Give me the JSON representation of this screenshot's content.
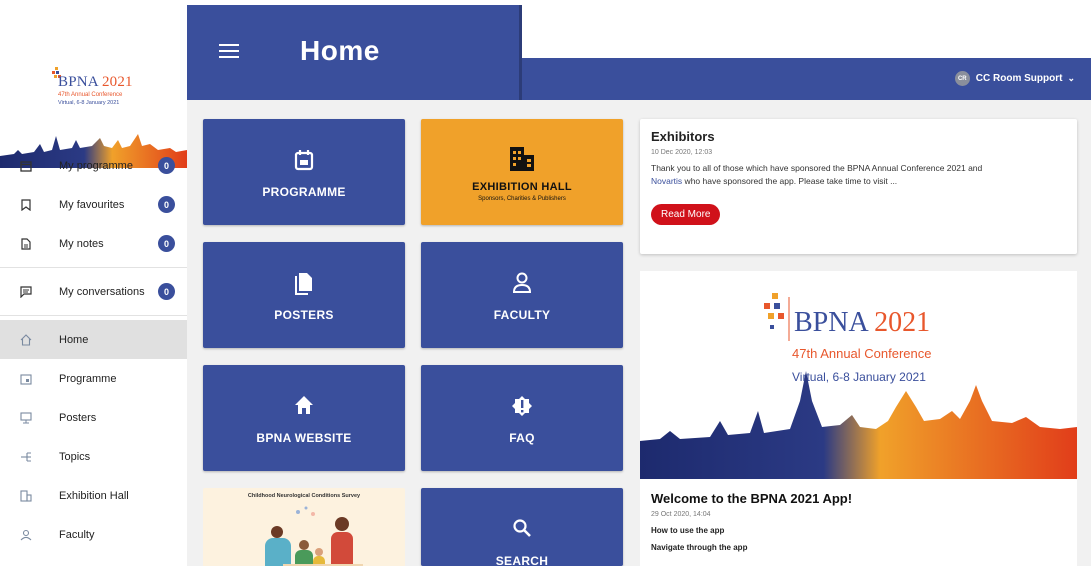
{
  "logo": {
    "title": "BPNA",
    "year": "2021",
    "subtitle": "47th Annual Conference",
    "dates": "Virtual, 6-8 January 2021"
  },
  "header": {
    "title": "Home",
    "user": {
      "initials": "CR",
      "name": "CC Room Support"
    }
  },
  "sidebar": {
    "items": [
      {
        "label": "My programme",
        "icon": "calendar-icon",
        "badge": "0"
      },
      {
        "label": "My favourites",
        "icon": "bookmark-icon",
        "badge": "0"
      },
      {
        "label": "My notes",
        "icon": "document-icon",
        "badge": "0"
      },
      {
        "label": "My conversations",
        "icon": "chat-icon",
        "badge": "0"
      },
      {
        "label": "Home",
        "icon": "home-icon",
        "active": true
      },
      {
        "label": "Programme",
        "icon": "calendar-icon"
      },
      {
        "label": "Posters",
        "icon": "presentation-icon"
      },
      {
        "label": "Topics",
        "icon": "topics-icon"
      },
      {
        "label": "Exhibition Hall",
        "icon": "building-icon"
      },
      {
        "label": "Faculty",
        "icon": "person-icon"
      }
    ]
  },
  "tiles": {
    "programme": "PROGRAMME",
    "exhibition": "EXHIBITION HALL",
    "exhibition_sub": "Sponsors, Charities & Publishers",
    "posters": "POSTERS",
    "faculty": "FACULTY",
    "website": "BPNA WEBSITE",
    "faq": "FAQ",
    "search": "SEARCH",
    "survey": "Childhood Neurological Conditions Survey"
  },
  "news": [
    {
      "title": "Exhibitors",
      "date": "10 Dec 2020, 12:03",
      "body_1": "Thank you to all of those which have sponsored the BPNA Annual Conference 2021 and",
      "body_link": "Novartis",
      "body_2": " who have sponsored the app. Please take time to visit ...",
      "button": "Read More"
    }
  ],
  "banner": {
    "title": "BPNA",
    "year": "2021",
    "line1": "47th Annual Conference",
    "line2": "Virtual, 6-8 January 2021"
  },
  "welcome": {
    "title": "Welcome to the BPNA 2021 App!",
    "date": "29 Oct 2020, 14:04",
    "link1": "How to use the app",
    "link2": "Navigate through the app"
  },
  "colors": {
    "primary": "#3a4f9c",
    "accent": "#f0a12a",
    "danger": "#d0111a"
  }
}
